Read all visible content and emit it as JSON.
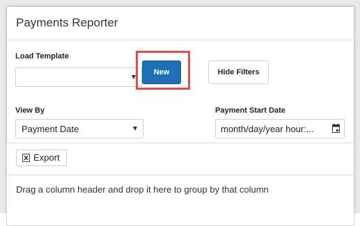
{
  "window": {
    "title": "Payments Reporter"
  },
  "filters": {
    "load_template_label": "Load Template",
    "load_template_value": "",
    "new_button": "New",
    "hide_filters_button": "Hide Filters",
    "view_by_label": "View By",
    "view_by_value": "Payment Date",
    "payment_start_date_label": "Payment Start Date",
    "payment_start_date_placeholder": "month/day/year hour:..."
  },
  "grid": {
    "export_button": "Export",
    "group_hint": "Drag a column header and drop it here to group by that column"
  },
  "colors": {
    "primary": "#1d6fb6",
    "highlight": "#e14b4b"
  },
  "icons": {
    "export": "excel-icon",
    "date_picker": "calendar-icon",
    "dropdown": "chevron-down-icon"
  }
}
